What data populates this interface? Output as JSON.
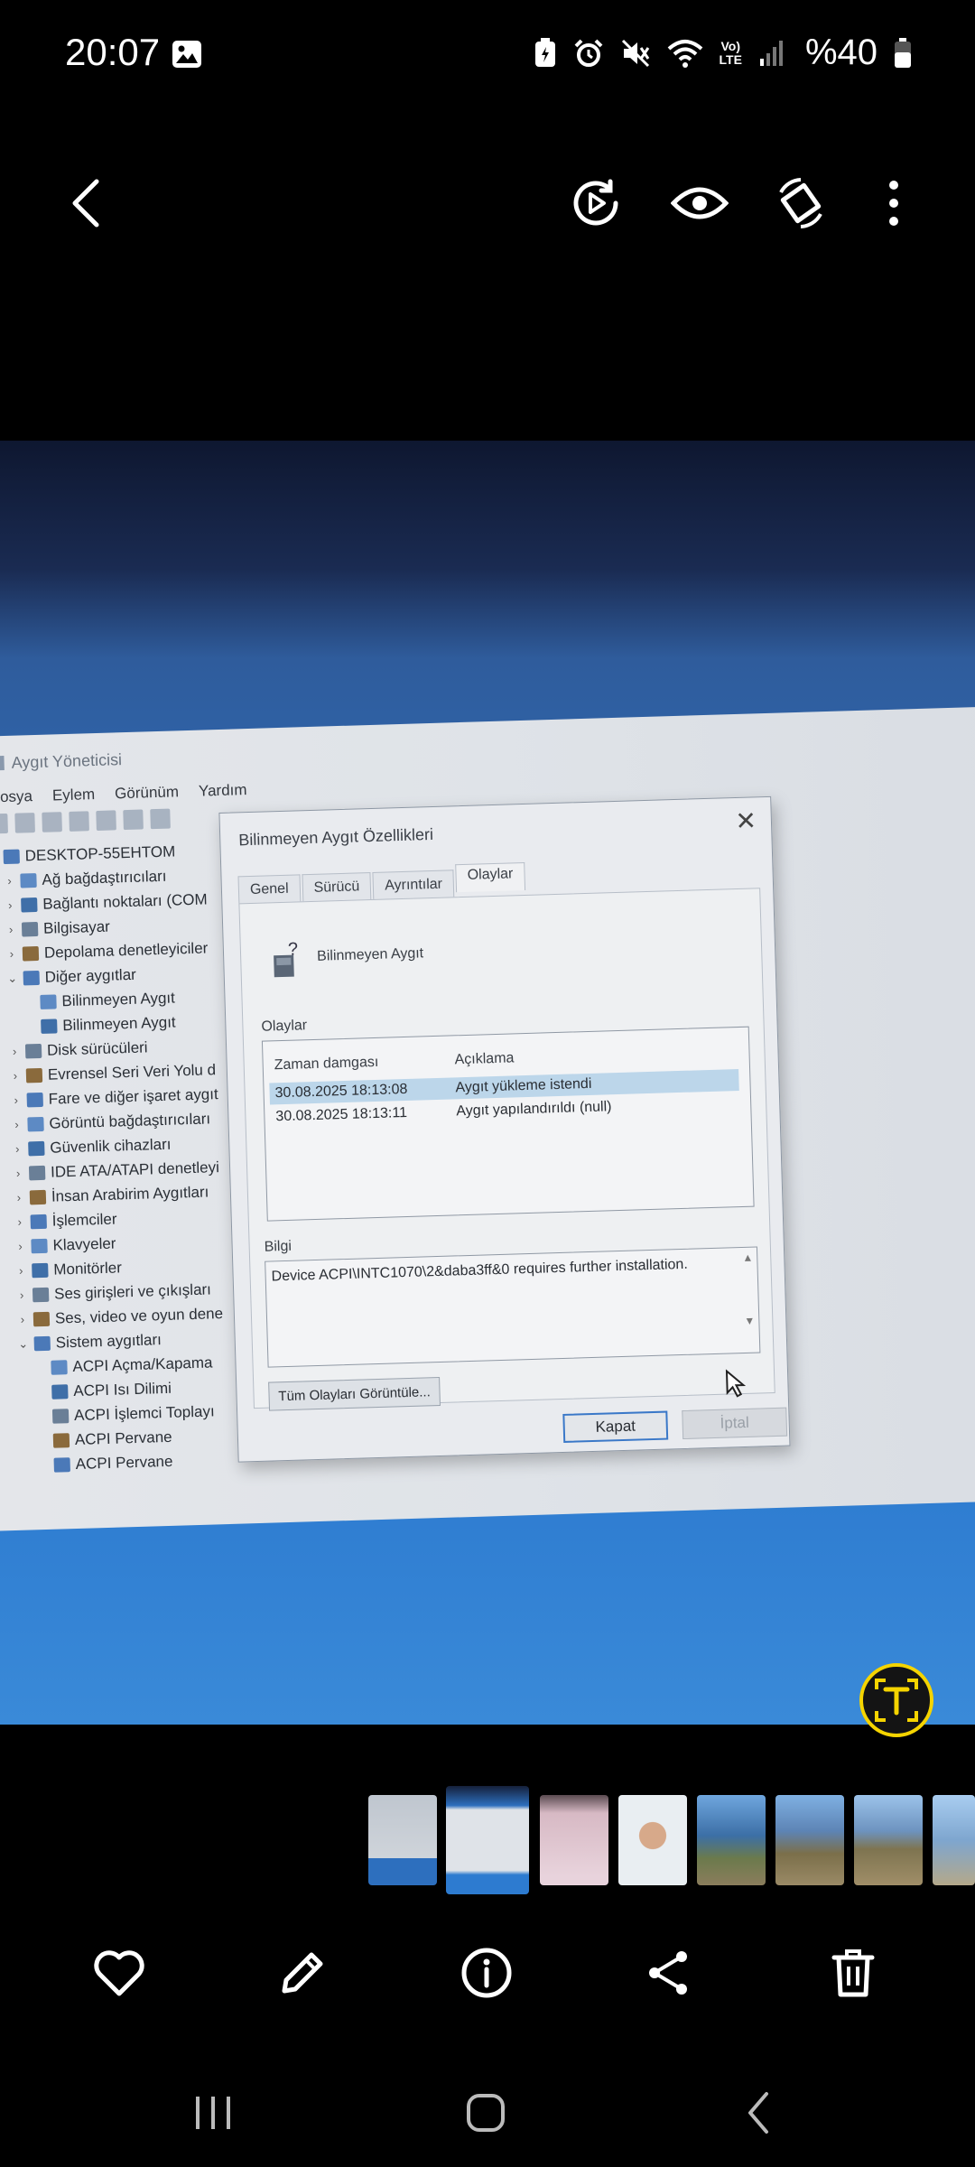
{
  "status_bar": {
    "time": "20:07",
    "battery": "%40",
    "network_label_top": "Vo)",
    "network_label_bottom": "LTE"
  },
  "top_bar": {
    "icons": [
      "back-arrow-icon",
      "motion-photo-play-icon",
      "eye-icon",
      "rotate-icon",
      "more-vertical-icon"
    ]
  },
  "photo": {
    "device_manager": {
      "title": "Aygıt Yöneticisi",
      "menu": [
        "Dosya",
        "Eylem",
        "Görünüm",
        "Yardım"
      ],
      "tree": [
        {
          "label": "DESKTOP-55EHTOM",
          "level": 0,
          "expander": "⌄"
        },
        {
          "label": "Ağ bağdaştırıcıları",
          "level": 1,
          "expander": "›"
        },
        {
          "label": "Bağlantı noktaları (COM",
          "level": 1,
          "expander": "›"
        },
        {
          "label": "Bilgisayar",
          "level": 1,
          "expander": "›"
        },
        {
          "label": "Depolama denetleyiciler",
          "level": 1,
          "expander": "›"
        },
        {
          "label": "Diğer aygıtlar",
          "level": 1,
          "expander": "⌄"
        },
        {
          "label": "Bilinmeyen Aygıt",
          "level": 2,
          "expander": ""
        },
        {
          "label": "Bilinmeyen Aygıt",
          "level": 2,
          "expander": ""
        },
        {
          "label": "Disk sürücüleri",
          "level": 1,
          "expander": "›"
        },
        {
          "label": "Evrensel Seri Veri Yolu d",
          "level": 1,
          "expander": "›"
        },
        {
          "label": "Fare ve diğer işaret aygıt",
          "level": 1,
          "expander": "›"
        },
        {
          "label": "Görüntü bağdaştırıcıları",
          "level": 1,
          "expander": "›"
        },
        {
          "label": "Güvenlik cihazları",
          "level": 1,
          "expander": "›"
        },
        {
          "label": "IDE ATA/ATAPI denetleyi",
          "level": 1,
          "expander": "›"
        },
        {
          "label": "İnsan Arabirim Aygıtları",
          "level": 1,
          "expander": "›"
        },
        {
          "label": "İşlemciler",
          "level": 1,
          "expander": "›"
        },
        {
          "label": "Klavyeler",
          "level": 1,
          "expander": "›"
        },
        {
          "label": "Monitörler",
          "level": 1,
          "expander": "›"
        },
        {
          "label": "Ses girişleri ve çıkışları",
          "level": 1,
          "expander": "›"
        },
        {
          "label": "Ses, video ve oyun dene",
          "level": 1,
          "expander": "›"
        },
        {
          "label": "Sistem aygıtları",
          "level": 1,
          "expander": "⌄"
        },
        {
          "label": "ACPI Açma/Kapama",
          "level": 2,
          "expander": ""
        },
        {
          "label": "ACPI Isı Dilimi",
          "level": 2,
          "expander": ""
        },
        {
          "label": "ACPI İşlemci Toplayı",
          "level": 2,
          "expander": ""
        },
        {
          "label": "ACPI Pervane",
          "level": 2,
          "expander": ""
        },
        {
          "label": "ACPI Pervane",
          "level": 2,
          "expander": ""
        }
      ]
    },
    "dialog": {
      "title": "Bilinmeyen Aygıt Özellikleri",
      "tabs": [
        "Genel",
        "Sürücü",
        "Ayrıntılar",
        "Olaylar"
      ],
      "active_tab": "Olaylar",
      "device_name": "Bilinmeyen Aygıt",
      "events_label": "Olaylar",
      "columns": [
        "Zaman damgası",
        "Açıklama"
      ],
      "events": [
        {
          "time": "30.08.2025 18:13:08",
          "desc": "Aygıt yükleme istendi",
          "selected": true
        },
        {
          "time": "30.08.2025 18:13:11",
          "desc": "Aygıt yapılandırıldı (null)",
          "selected": false
        }
      ],
      "info_label": "Bilgi",
      "info_text": "Device ACPI\\INTC1070\\2&daba3ff&0 requires further installation.",
      "view_all_button": "Tüm Olayları Görüntüle...",
      "close_button": "Kapat",
      "cancel_button": "İptal"
    }
  },
  "thumbnails": {
    "count": 8,
    "current_index": 1
  },
  "bottom_actions": {
    "icons": [
      "heart-icon",
      "edit-pencil-icon",
      "info-icon",
      "share-icon",
      "trash-icon"
    ]
  },
  "nav_bar": {
    "icons": [
      "recent-apps-icon",
      "home-icon",
      "back-icon"
    ]
  },
  "colors": {
    "accent_yellow": "#f5d400",
    "selection_blue": "#bcd6ea",
    "desktop_blue": "#2d6fbe"
  }
}
